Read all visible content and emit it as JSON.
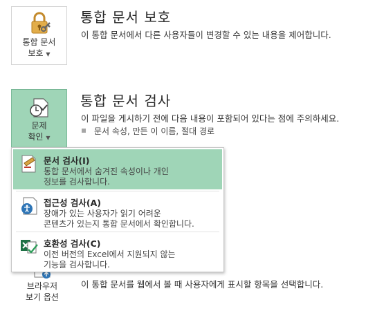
{
  "protect": {
    "button_line1": "통합 문서",
    "button_line2": "보호",
    "title": "통합 문서 보호",
    "description": "이 통합 문서에서 다른 사용자들이 변경할 수 있는 내용을 제어합니다."
  },
  "inspect": {
    "button_line1": "문제",
    "button_line2": "확인",
    "title": "통합 문서 검사",
    "description": "이 파일을 게시하기 전에 다음 내용이 포함되어 있다는 점에 주의하세요.",
    "bullet": "문서 속성, 만든 이 이름, 절대 경로"
  },
  "menu": {
    "items": [
      {
        "title": "문서 검사(I)",
        "desc1": "통합 문서에서 숨겨진 속성이나 개인",
        "desc2": "정보를 검사합니다.",
        "icon": "document-inspect-icon"
      },
      {
        "title": "접근성 검사(A)",
        "desc1": "장애가 있는 사용자가 읽기 어려운",
        "desc2": "콘텐츠가 있는지 통합 문서에서 확인합니다.",
        "icon": "accessibility-check-icon"
      },
      {
        "title": "호환성 검사(C)",
        "desc1": "이전 버전의 Excel에서 지원되지 않는",
        "desc2": "기능을 검사합니다.",
        "icon": "compatibility-check-icon"
      }
    ]
  },
  "browser": {
    "button_line1": "브라우저",
    "button_line2": "보기 옵션",
    "description": "이 통합 문서를 웹에서 볼 때 사용자에게 표시할 항목을 선택합니다."
  },
  "colors": {
    "highlight": "#9fd5b7",
    "gold": "#d9a441",
    "accent": "#2e75b6"
  }
}
